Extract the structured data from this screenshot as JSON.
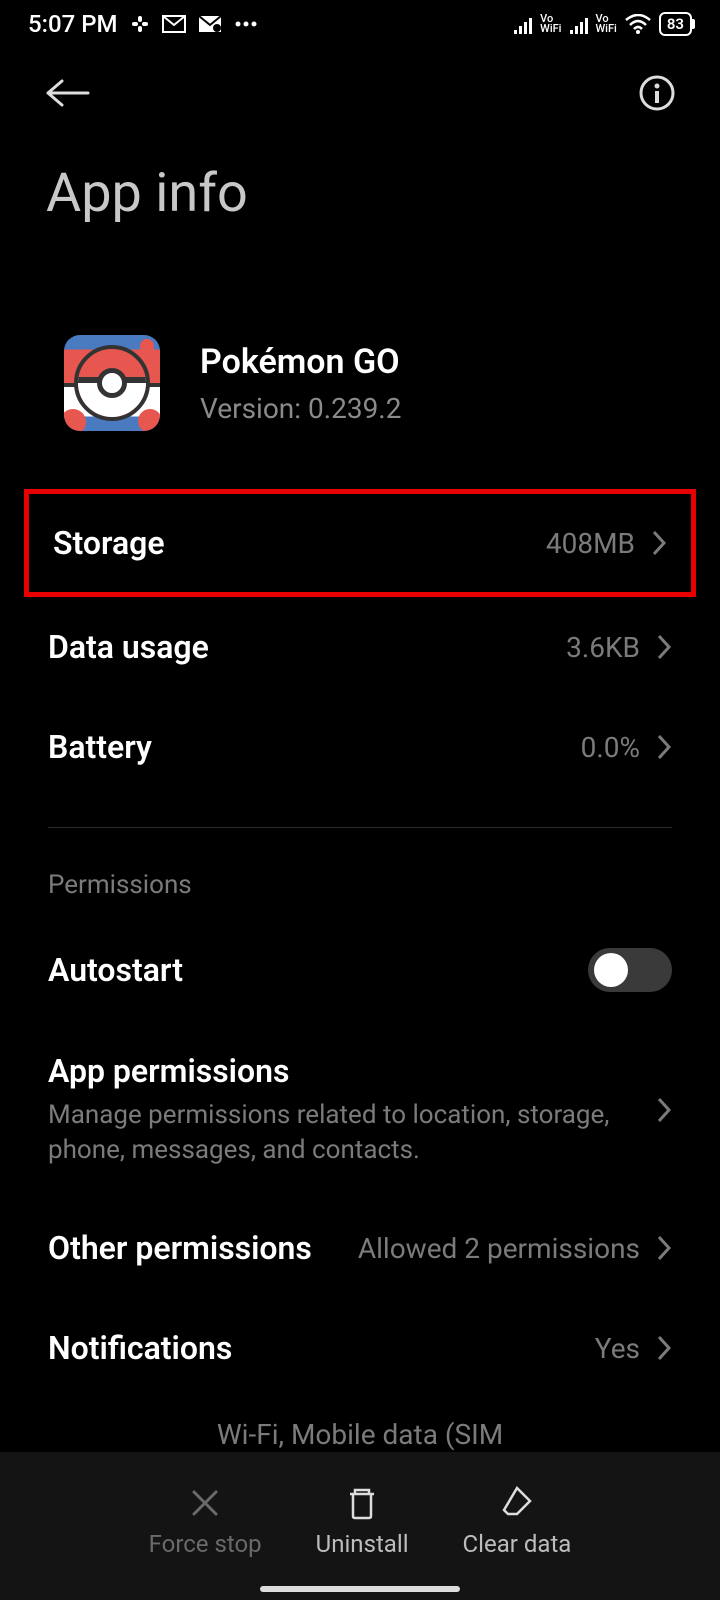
{
  "status": {
    "time": "5:07 PM",
    "battery": "83"
  },
  "header": {
    "title": "App info"
  },
  "app": {
    "name": "Pokémon GO",
    "version": "Version: 0.239.2"
  },
  "rows": {
    "storage": {
      "label": "Storage",
      "value": "408MB"
    },
    "data_usage": {
      "label": "Data usage",
      "value": "3.6KB"
    },
    "battery": {
      "label": "Battery",
      "value": "0.0%"
    }
  },
  "permissions": {
    "section_label": "Permissions",
    "autostart": {
      "label": "Autostart"
    },
    "app_permissions": {
      "label": "App permissions",
      "sub": "Manage permissions related to location, storage, phone, messages, and contacts."
    },
    "other_permissions": {
      "label": "Other permissions",
      "value": "Allowed 2 permissions"
    },
    "notifications": {
      "label": "Notifications",
      "value": "Yes"
    },
    "partial": "Wi-Fi, Mobile data (SIM"
  },
  "bottom": {
    "force_stop": "Force stop",
    "uninstall": "Uninstall",
    "clear_data": "Clear data"
  }
}
